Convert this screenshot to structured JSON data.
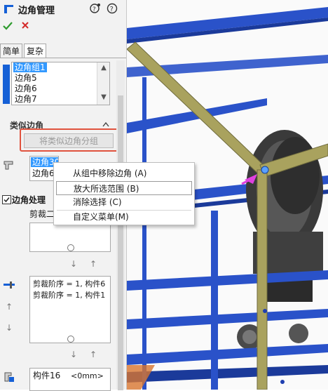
{
  "header": {
    "title": "边角管理"
  },
  "tabs": {
    "simple": "简单",
    "complex": "复杂"
  },
  "corner_groups": {
    "items": [
      "边角组1",
      "边角5",
      "边角6",
      "边角7"
    ]
  },
  "similar_corners": {
    "heading": "类似边角",
    "button_label": "将类似边角分组",
    "list": [
      "边角30",
      "边角6"
    ]
  },
  "corner_treatment": {
    "label": "边角处理",
    "trim_label": "剪裁二",
    "trim_order_lines": [
      "剪裁阶序 = 1, 构件6",
      "剪裁阶序 = 1, 构件1"
    ],
    "member_text": "构件16",
    "member_value": "<0mm>"
  },
  "context_menu": {
    "items": [
      "从组中移除边角 (A)",
      "放大所选范围 (B)",
      "消除选择 (C)",
      "自定义菜单(M)"
    ]
  },
  "colors": {
    "accent_blue": "#1560d6",
    "frame_gold": "#a9a25e",
    "beam_blue": "#2a52c9",
    "highlight_red": "#e0533e"
  }
}
